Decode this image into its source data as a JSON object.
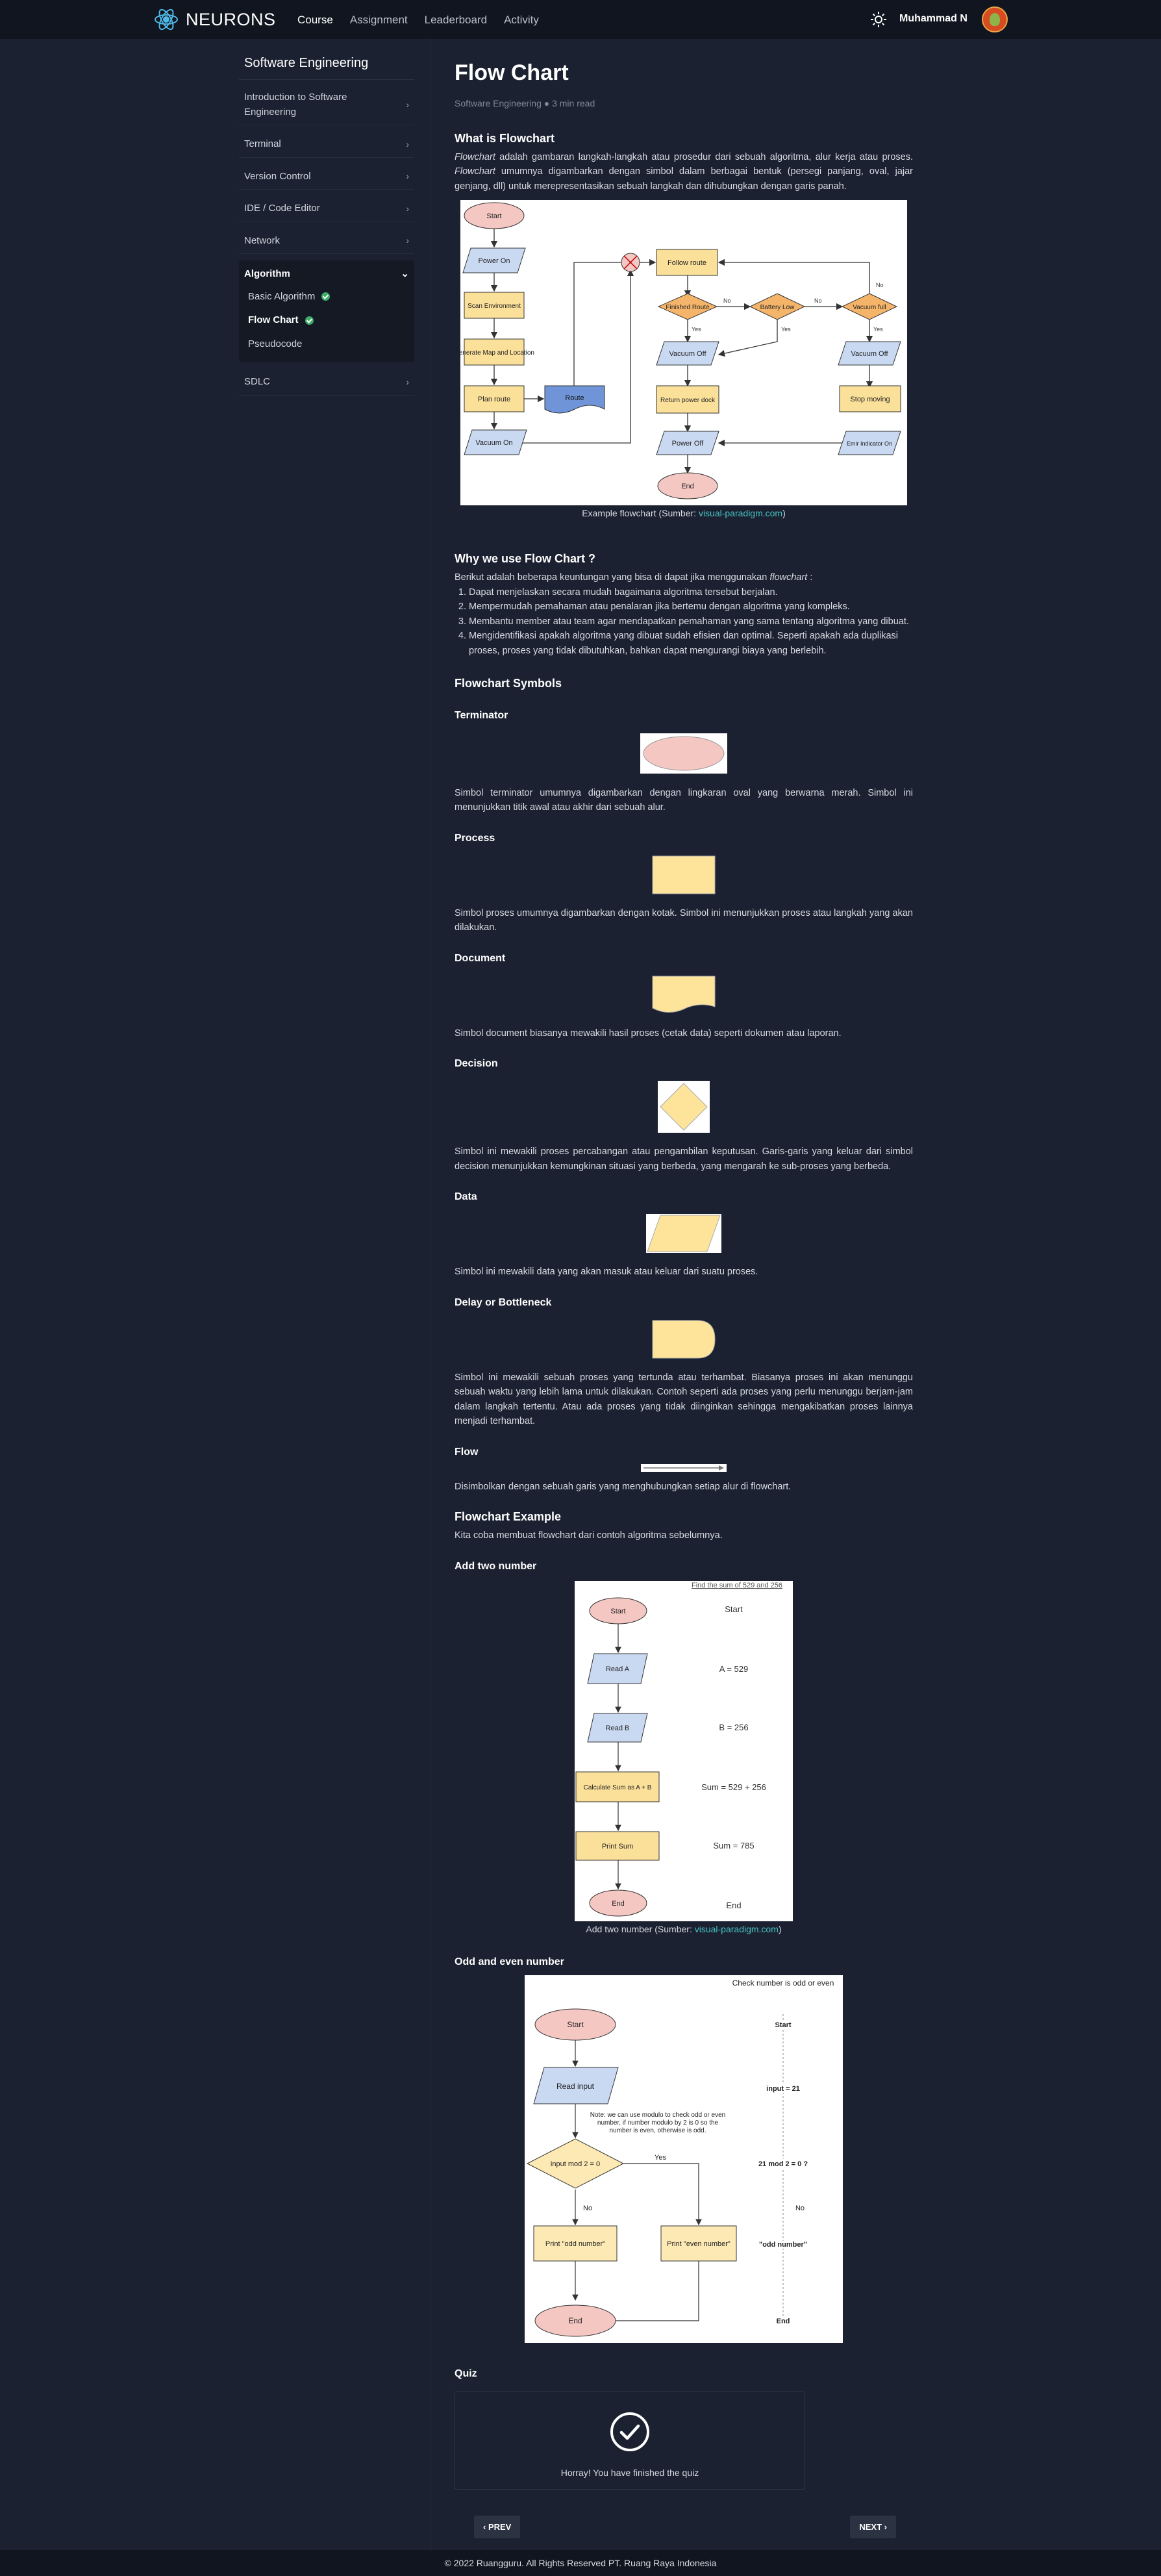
{
  "header": {
    "brand": "NEURONS",
    "nav": [
      "Course",
      "Assignment",
      "Leaderboard",
      "Activity"
    ],
    "user": "Muhammad N"
  },
  "sidebar": {
    "title": "Software Engineering",
    "items": [
      {
        "label": "Introduction to Software Engineering"
      },
      {
        "label": "Terminal"
      },
      {
        "label": "Version Control"
      },
      {
        "label": "IDE / Code Editor"
      },
      {
        "label": "Network"
      }
    ],
    "group": {
      "label": "Algorithm",
      "subitems": [
        "Basic Algorithm",
        "Flow Chart",
        "Pseudocode"
      ]
    },
    "last_item": "SDLC"
  },
  "article": {
    "title": "Flow Chart",
    "meta": "Software Engineering ● 3 min read",
    "what_heading": "What is Flowchart",
    "what_p1_em": "Flowchart",
    "what_p1": " adalah gambaran langkah-langkah atau prosedur dari sebuah algoritma, alur kerja atau proses. ",
    "what_p1_em2": "Flowchart",
    "what_p1b": " umumnya digambarkan dengan simbol dalam berbagai bentuk (persegi panjang, oval, jajar genjang, dll) untuk merepresentasikan sebuah langkah dan dihubungkan dengan garis panah.",
    "caption1": "Example flowchart (Sumber: ",
    "caption1_link": "visual-paradigm.com",
    "caption1_end": ")",
    "why_heading": "Why we use Flow Chart ?",
    "why_intro": "Berikut adalah beberapa keuntungan yang bisa di dapat jika menggunakan ",
    "why_intro_em": "flowchart",
    "why_intro_end": " :",
    "why_list": [
      "Dapat menjelaskan secara mudah bagaimana algoritma tersebut berjalan.",
      "Mempermudah pemahaman atau penalaran jika bertemu dengan algoritma yang kompleks.",
      "Membantu member atau team agar mendapatkan pemahaman yang sama tentang algoritma yang dibuat.",
      "Mengidentifikasi apakah algoritma yang dibuat sudah efisien dan optimal. Seperti apakah ada duplikasi proses, proses yang tidak dibutuhkan, bahkan dapat mengurangi biaya yang berlebih."
    ],
    "symbols_heading": "Flowchart Symbols",
    "symbols": [
      {
        "name": "Terminator",
        "desc": "Simbol terminator umumnya digambarkan dengan lingkaran oval yang berwarna merah. Simbol ini menunjukkan titik awal atau akhir dari sebuah alur."
      },
      {
        "name": "Process",
        "desc": "Simbol proses umumnya digambarkan dengan kotak. Simbol ini menunjukkan proses atau langkah yang akan dilakukan."
      },
      {
        "name": "Document",
        "desc": "Simbol document biasanya mewakili hasil proses (cetak data) seperti dokumen atau laporan."
      },
      {
        "name": "Decision",
        "desc": "Simbol ini mewakili proses percabangan atau pengambilan keputusan. Garis-garis yang keluar dari simbol decision menunjukkan kemungkinan situasi yang berbeda, yang mengarah ke sub-proses yang berbeda."
      },
      {
        "name": "Data",
        "desc": "Simbol ini mewakili data yang akan masuk atau keluar dari suatu proses."
      },
      {
        "name": "Delay or Bottleneck",
        "desc": "Simbol ini mewakili sebuah proses yang tertunda atau terhambat. Biasanya proses ini akan menunggu sebuah waktu yang lebih lama untuk dilakukan. Contoh seperti ada proses yang perlu menunggu berjam-jam dalam langkah tertentu. Atau ada proses yang tidak diinginkan sehingga mengakibatkan proses lainnya menjadi terhambat."
      },
      {
        "name": "Flow",
        "desc": "Disimbolkan dengan sebuah garis yang menghubungkan setiap alur di flowchart."
      }
    ],
    "example_heading": "Flowchart Example",
    "example_intro": "Kita coba membuat flowchart dari contoh algoritma sebelumnya.",
    "add_heading": "Add two number",
    "caption2": "Add two number (Sumber: ",
    "caption2_link": "visual-paradigm.com",
    "caption2_end": ")",
    "odd_heading": "Odd and even number",
    "quiz_heading": "Quiz",
    "quiz_text": "Horray! You have finished the quiz",
    "prev": "‹ PREV",
    "next": "NEXT ›"
  },
  "diagram1": {
    "nodes": [
      "Start",
      "Power On",
      "Scan Environment",
      "Generate Map and Location",
      "Plan route",
      "Route",
      "Vacuum On",
      "Follow route",
      "Finished Route",
      "Battery Low",
      "Vacuum full",
      "Vacuum Off",
      "Return power dock",
      "Stop moving",
      "Power Off",
      "Emir Indicator On",
      "End"
    ],
    "labels": [
      "Yes",
      "No"
    ]
  },
  "diagram2": {
    "title": "Find the sum of 529 and 256",
    "nodes": [
      "Start",
      "Read A",
      "Read B",
      "Calculate Sum as A + B",
      "Print Sum",
      "End"
    ],
    "right": [
      "Start",
      "A = 529",
      "B = 256",
      "Sum = 529 + 256",
      "Sum = 785",
      "End"
    ]
  },
  "diagram3": {
    "title": "Check number is odd or even",
    "nodes": [
      "Start",
      "Read input",
      "input mod 2 = 0",
      "Print \"odd number\"",
      "Print \"even number\"",
      "End"
    ],
    "note": "Note: we can use modulo to check odd or even number, if number modulo by 2 is 0 so the number is even, otherwise is odd.",
    "yes": "Yes",
    "no": "No",
    "right": [
      "Start",
      "input = 21",
      "21 mod 2 = 0 ?",
      "No",
      "\"odd number\"",
      "End"
    ]
  },
  "footer": "© 2022 Ruangguru. All Rights Reserved PT. Ruang Raya Indonesia"
}
